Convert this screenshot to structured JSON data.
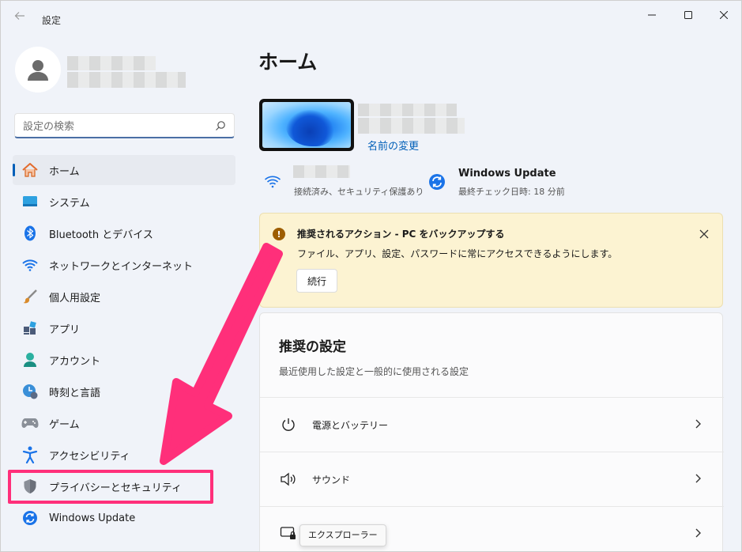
{
  "window": {
    "title": "設定"
  },
  "sidebar": {
    "search_placeholder": "設定の検索",
    "items": [
      {
        "label": "ホーム",
        "icon": "home-icon",
        "active": true
      },
      {
        "label": "システム",
        "icon": "system-icon"
      },
      {
        "label": "Bluetooth とデバイス",
        "icon": "bluetooth-icon"
      },
      {
        "label": "ネットワークとインターネット",
        "icon": "network-icon"
      },
      {
        "label": "個人用設定",
        "icon": "brush-icon"
      },
      {
        "label": "アプリ",
        "icon": "apps-icon"
      },
      {
        "label": "アカウント",
        "icon": "account-icon"
      },
      {
        "label": "時刻と言語",
        "icon": "time-language-icon"
      },
      {
        "label": "ゲーム",
        "icon": "gamepad-icon"
      },
      {
        "label": "アクセシビリティ",
        "icon": "accessibility-icon"
      },
      {
        "label": "プライバシーとセキュリティ",
        "icon": "shield-icon"
      },
      {
        "label": "Windows Update",
        "icon": "windows-update-icon"
      }
    ]
  },
  "main": {
    "page_title": "ホーム",
    "rename_link": "名前の変更",
    "network_status": "接続済み、セキュリティ保護あり",
    "windows_update": {
      "title": "Windows Update",
      "subtitle": "最終チェック日時: 18 分前"
    },
    "banner": {
      "title": "推奨されるアクション - PC をバックアップする",
      "description": "ファイル、アプリ、設定、パスワードに常にアクセスできるようにします。",
      "button_label": "続行"
    },
    "recommended": {
      "title": "推奨の設定",
      "subtitle": "最近使用した設定と一般的に使用される設定",
      "rows": [
        {
          "label": "電源とバッテリー",
          "icon": "power-icon"
        },
        {
          "label": "サウンド",
          "icon": "speaker-icon"
        },
        {
          "label": "",
          "icon": "display-lock-icon"
        }
      ]
    },
    "tooltip": "エクスプローラー"
  },
  "colors": {
    "accent": "#005fb8",
    "annotation": "#ff2f7a",
    "banner_bg": "#fcf3d2",
    "warning": "#9d5d00"
  }
}
